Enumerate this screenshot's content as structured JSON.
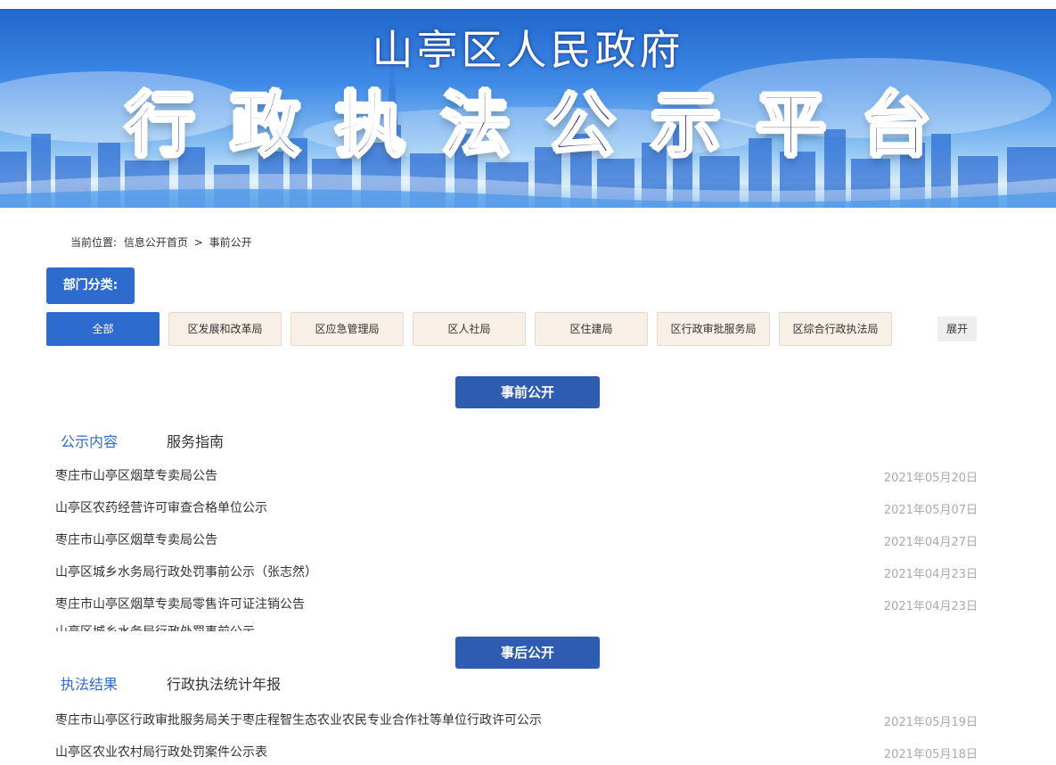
{
  "banner": {
    "subtitle": "山亭区人民政府",
    "title": "行政执法公示平台"
  },
  "breadcrumb": {
    "prefix": "当前位置:",
    "home": "信息公开首页",
    "separator": ">",
    "current": "事前公开"
  },
  "department": {
    "label": "部门分类:",
    "items": [
      {
        "label": "全部",
        "active": true
      },
      {
        "label": "区发展和改革局",
        "active": false
      },
      {
        "label": "区应急管理局",
        "active": false
      },
      {
        "label": "区人社局",
        "active": false
      },
      {
        "label": "区住建局",
        "active": false
      },
      {
        "label": "区行政审批服务局",
        "active": false
      },
      {
        "label": "区综合行政执法局",
        "active": false
      }
    ],
    "expand_label": "展开"
  },
  "pre_disclosure": {
    "header": "事前公开",
    "tabs": [
      {
        "label": "公示内容",
        "active": true
      },
      {
        "label": "服务指南",
        "active": false
      }
    ],
    "items": [
      {
        "title": "枣庄市山亭区烟草专卖局公告",
        "date": "2021年05月20日"
      },
      {
        "title": "山亭区农药经营许可审查合格单位公示",
        "date": "2021年05月07日"
      },
      {
        "title": "枣庄市山亭区烟草专卖局公告",
        "date": "2021年04月27日"
      },
      {
        "title": "山亭区城乡水务局行政处罚事前公示（张志然）",
        "date": "2021年04月23日"
      },
      {
        "title": "枣庄市山亭区烟草专卖局零售许可证注销公告",
        "date": "2021年04月23日"
      }
    ],
    "partial_item": "山亭区城乡水务局行政处罚事前公示"
  },
  "post_disclosure": {
    "header": "事后公开",
    "tabs": [
      {
        "label": "执法结果",
        "active": true
      },
      {
        "label": "行政执法统计年报",
        "active": false
      }
    ],
    "items": [
      {
        "title": "枣庄市山亭区行政审批服务局关于枣庄程智生态农业农民专业合作社等单位行政许可公示",
        "date": "2021年05月19日"
      },
      {
        "title": "山亭区农业农村局行政处罚案件公示表",
        "date": "2021年05月18日"
      }
    ]
  },
  "colors": {
    "primary": "#2d6bcf",
    "section": "#2d5cb0",
    "dept_bg": "#f8efe6",
    "date": "#aaaaaa"
  }
}
